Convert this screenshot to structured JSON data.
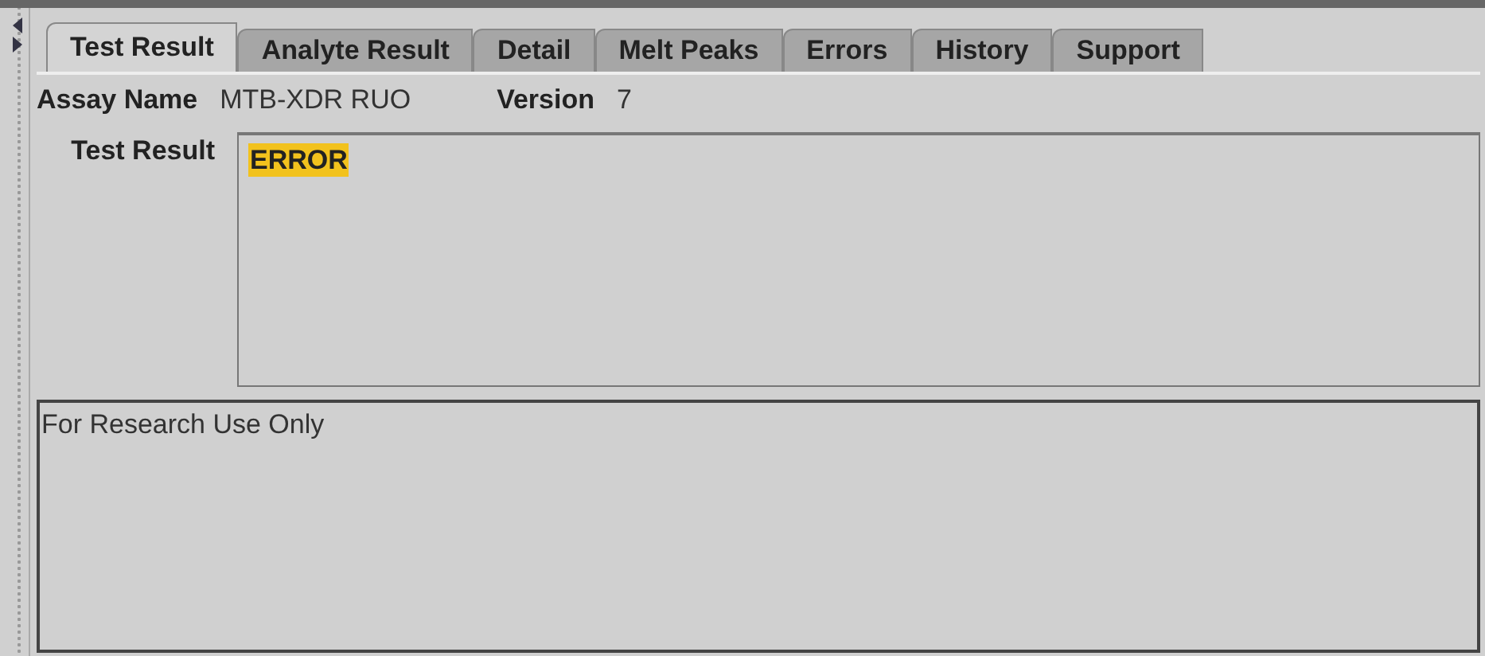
{
  "tabs": [
    {
      "label": "Test Result",
      "selected": true
    },
    {
      "label": "Analyte Result",
      "selected": false
    },
    {
      "label": "Detail",
      "selected": false
    },
    {
      "label": "Melt Peaks",
      "selected": false
    },
    {
      "label": "Errors",
      "selected": false
    },
    {
      "label": "History",
      "selected": false
    },
    {
      "label": "Support",
      "selected": false
    }
  ],
  "assay": {
    "name_label": "Assay Name",
    "name": "MTB-XDR RUO",
    "version_label": "Version",
    "version": "7"
  },
  "test_result": {
    "label": "Test Result",
    "value": "ERROR",
    "highlighted": true
  },
  "notes": "For Research Use Only"
}
